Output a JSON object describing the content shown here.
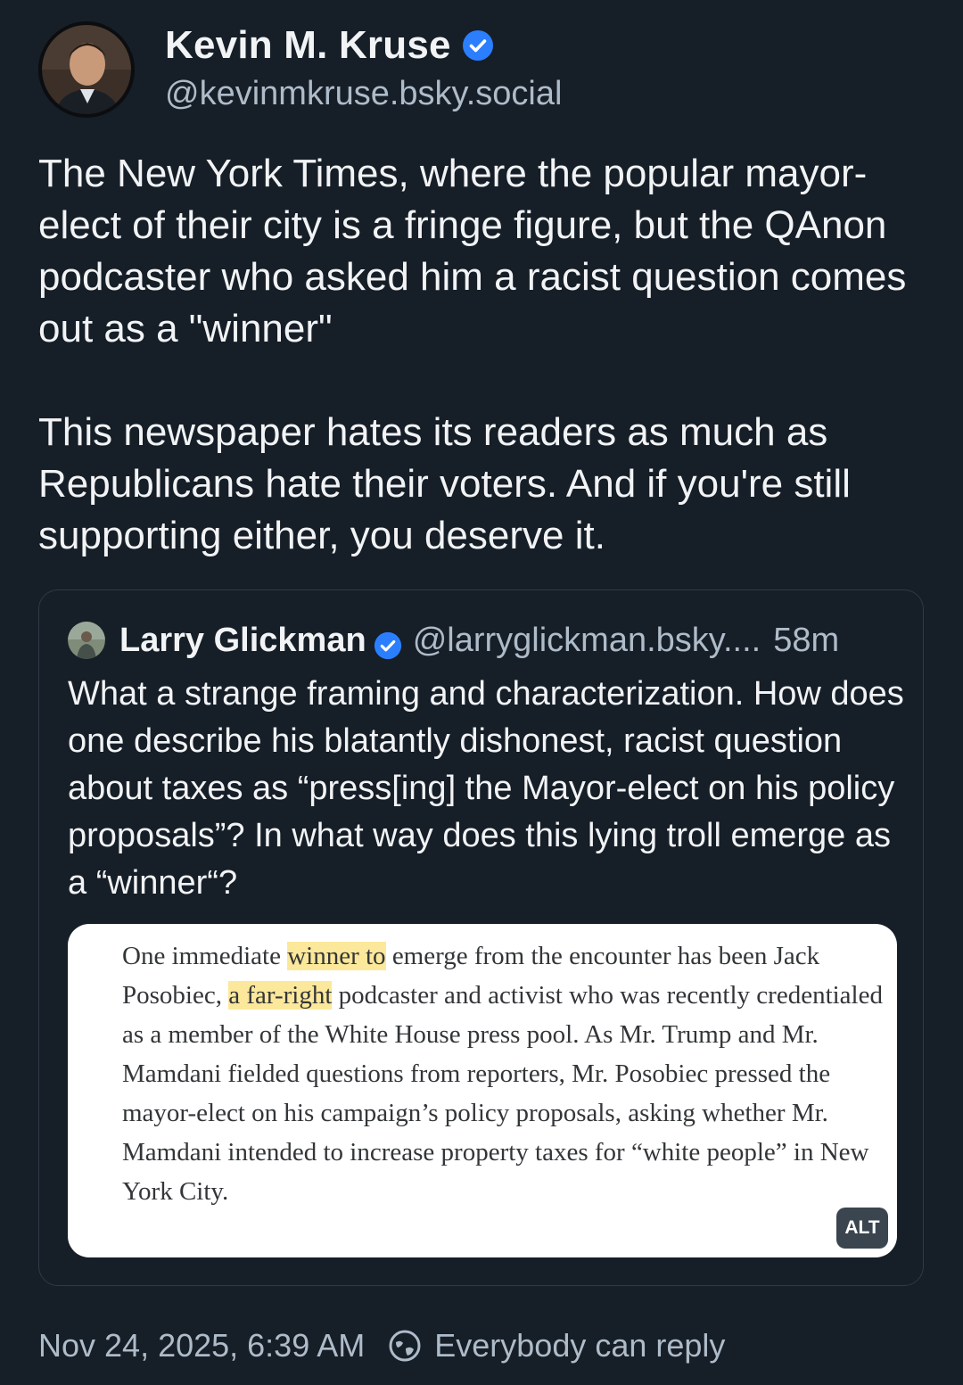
{
  "author": {
    "display_name": "Kevin M. Kruse",
    "handle": "@kevinmkruse.bsky.social",
    "verified": true
  },
  "post": {
    "text": "The New York Times, where the popular mayor-elect of their city is a fringe figure, but the QAnon podcaster who asked him a racist question comes out as a \"winner\"\n\nThis newspaper hates its readers as much as Republicans hate their voters. And if you're still supporting either, you deserve it."
  },
  "quote": {
    "display_name": "Larry Glickman",
    "handle": "@larryglickman.bsky....",
    "time": "58m",
    "text": "What a strange framing and characterization. How does one describe his blatantly dishonest, racist question about taxes as “press[ing] the Mayor-elect on his policy proposals”? In what way does this lying troll emerge as a “winner“?",
    "image": {
      "article_before_1": "One immediate ",
      "article_hl_1": "winner to",
      "article_mid": " emerge from the encounter has been Jack Posobiec, ",
      "article_hl_2": "a far-right",
      "article_after": " podcaster and activist who was recently credentialed as a member of the White House press pool. As Mr. Trump and Mr. Mamdani fielded questions from reporters, Mr. Posobiec pressed the mayor-elect on his campaign’s policy proposals, asking whether Mr. Mamdani intended to increase property taxes for “white people” in New York City.",
      "alt_label": "ALT"
    }
  },
  "footer": {
    "timestamp": "Nov 24, 2025, 6:39 AM",
    "reply_setting": "Everybody can reply"
  },
  "colors": {
    "background": "#161e27",
    "text": "#f1f3f5",
    "muted": "#aebbc9",
    "verified_blue": "#2b7fff",
    "highlight": "#fbe89a"
  }
}
